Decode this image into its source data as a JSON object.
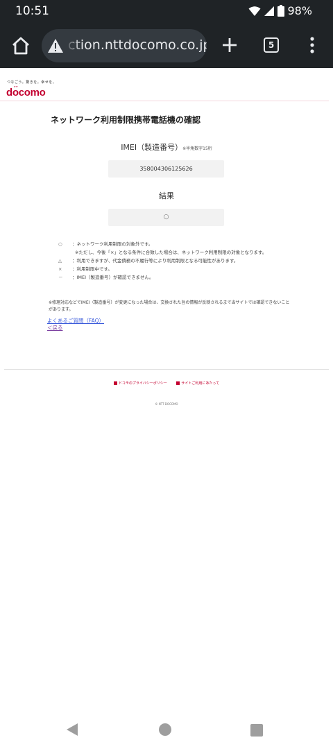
{
  "status": {
    "time": "10:51",
    "battery": "98%"
  },
  "browser": {
    "url": "ction.nttdocomo.co.jp",
    "tab_count": "5"
  },
  "page": {
    "tagline": "つなごう。驚きを。幸せを。",
    "logo_small": "NTT",
    "logo": "docomo",
    "title": "ネットワーク利用制限携帯電話機の確認",
    "imei_label": "IMEI（製造番号）",
    "imei_note": "※半角数字15桁",
    "imei_value": "358004306125626",
    "result_label": "結果",
    "result_value": "○",
    "legend": [
      {
        "symbol": "○",
        "text": "：ネットワーク利用制限の対象外です。"
      },
      {
        "symbol": "",
        "text": "※ただし、今後「×」となる条件に合致した場合は、ネットワーク利用制限の対象となります。",
        "sub": true
      },
      {
        "symbol": "△",
        "text": "：利用できますが、代金債務の不履行等により利用制限となる可能性があります。"
      },
      {
        "symbol": "×",
        "text": "：利用制限中です。"
      },
      {
        "symbol": "－",
        "text": "：IMEI（製造番号）が確認できません。"
      }
    ],
    "footnote": "※修理対応などでIMEI（製造番号）が変更になった場合は、交換された旨の情報が反映されるまで当サイトでは確認できないことがあります。",
    "faq_link": "よくあるご質問（FAQ）",
    "back_link": "＜戻る",
    "footer_link_1": "ドコモのプライバシーポリシー",
    "footer_link_2": "サイトご利用にあたって",
    "copyright": "© NTT DOCOMO"
  }
}
